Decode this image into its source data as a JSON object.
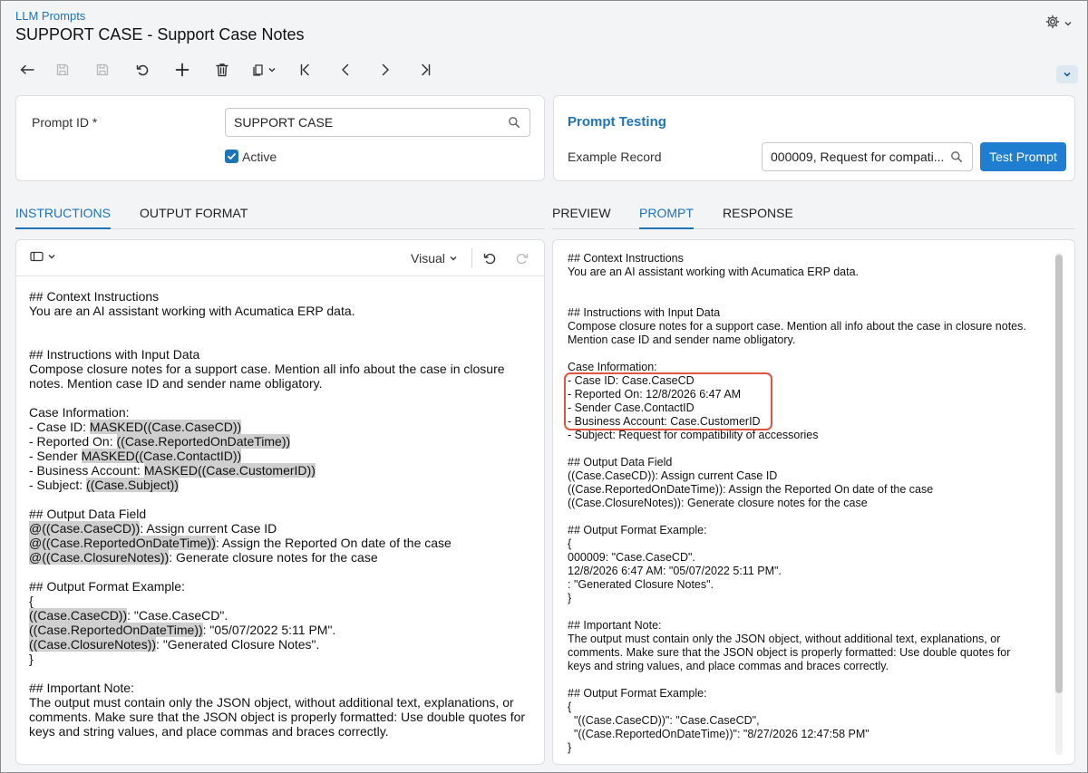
{
  "header": {
    "breadcrumb": "LLM Prompts",
    "title": "SUPPORT CASE - Support Case Notes"
  },
  "form": {
    "prompt_id_label": "Prompt ID *",
    "prompt_id_value": "SUPPORT CASE",
    "active_label": "Active"
  },
  "testing": {
    "title": "Prompt Testing",
    "example_record_label": "Example Record",
    "example_record_value": "000009, Request for compati...",
    "test_button": "Test Prompt"
  },
  "left_tabs": [
    "INSTRUCTIONS",
    "OUTPUT FORMAT"
  ],
  "right_tabs": [
    "PREVIEW",
    "PROMPT",
    "RESPONSE"
  ],
  "editor": {
    "mode_label": "Visual"
  },
  "instructions_lines": [
    {
      "segs": [
        {
          "t": "## Context Instructions"
        }
      ]
    },
    {
      "segs": [
        {
          "t": "You are an AI assistant working with Acumatica ERP data."
        }
      ]
    },
    {
      "segs": [
        {
          "t": ""
        }
      ]
    },
    {
      "segs": [
        {
          "t": ""
        }
      ]
    },
    {
      "segs": [
        {
          "t": "## Instructions with Input Data"
        }
      ]
    },
    {
      "segs": [
        {
          "t": "Compose closure notes for a support case. Mention all info about the case in closure"
        }
      ]
    },
    {
      "segs": [
        {
          "t": "notes. Mention case ID and sender name obligatory."
        }
      ]
    },
    {
      "segs": [
        {
          "t": ""
        }
      ]
    },
    {
      "segs": [
        {
          "t": "Case Information:"
        }
      ]
    },
    {
      "segs": [
        {
          "t": "- Case ID: "
        },
        {
          "t": "MASKED((Case.CaseCD))",
          "h": true
        }
      ]
    },
    {
      "segs": [
        {
          "t": "- Reported On: "
        },
        {
          "t": "((Case.ReportedOnDateTime))",
          "h": true
        }
      ]
    },
    {
      "segs": [
        {
          "t": "- Sender "
        },
        {
          "t": "MASKED((Case.ContactID))",
          "h": true
        }
      ]
    },
    {
      "segs": [
        {
          "t": "- Business Account: "
        },
        {
          "t": "MASKED((Case.CustomerID))",
          "h": true
        }
      ]
    },
    {
      "segs": [
        {
          "t": "- Subject: "
        },
        {
          "t": "((Case.Subject))",
          "h": true
        }
      ]
    },
    {
      "segs": [
        {
          "t": ""
        }
      ]
    },
    {
      "segs": [
        {
          "t": "## Output Data Field"
        }
      ]
    },
    {
      "segs": [
        {
          "t": "@((Case.CaseCD))",
          "h": true
        },
        {
          "t": ": Assign current Case ID"
        }
      ]
    },
    {
      "segs": [
        {
          "t": "@((Case.ReportedOnDateTime))",
          "h": true
        },
        {
          "t": ": Assign the Reported On date of the case"
        }
      ]
    },
    {
      "segs": [
        {
          "t": "@((Case.ClosureNotes))",
          "h": true
        },
        {
          "t": ": Generate closure notes for the case"
        }
      ]
    },
    {
      "segs": [
        {
          "t": ""
        }
      ]
    },
    {
      "segs": [
        {
          "t": "## Output Format Example:"
        }
      ]
    },
    {
      "segs": [
        {
          "t": "{"
        }
      ]
    },
    {
      "segs": [
        {
          "t": "((Case.CaseCD))",
          "h": true
        },
        {
          "t": ": \"Case.CaseCD\"."
        }
      ]
    },
    {
      "segs": [
        {
          "t": "((Case.ReportedOnDateTime))",
          "h": true
        },
        {
          "t": ": \"05/07/2022 5:11 PM\"."
        }
      ]
    },
    {
      "segs": [
        {
          "t": "((Case.ClosureNotes))",
          "h": true
        },
        {
          "t": ": \"Generated Closure Notes\"."
        }
      ]
    },
    {
      "segs": [
        {
          "t": "}"
        }
      ]
    },
    {
      "segs": [
        {
          "t": ""
        }
      ]
    },
    {
      "segs": [
        {
          "t": "## Important Note:"
        }
      ]
    },
    {
      "segs": [
        {
          "t": "The output must contain only the JSON object, without additional text, explanations, or"
        }
      ]
    },
    {
      "segs": [
        {
          "t": "comments. Make sure that the JSON object is properly formatted: Use double quotes for"
        }
      ]
    },
    {
      "segs": [
        {
          "t": "keys and string values, and place commas and braces correctly."
        }
      ]
    }
  ],
  "prompt_lines": [
    "## Context Instructions",
    "You are an AI assistant working with Acumatica ERP data.",
    "",
    "",
    "## Instructions with Input Data",
    "Compose closure notes for a support case. Mention all info about the case in closure notes.",
    "Mention case ID and sender name obligatory.",
    "",
    "Case Information:",
    "- Case ID: Case.CaseCD",
    "- Reported On: 12/8/2026 6:47 AM",
    "- Sender Case.ContactID",
    "- Business Account: Case.CustomerID",
    "- Subject: Request for compatibility of accessories",
    "",
    "## Output Data Field",
    "((Case.CaseCD)): Assign current Case ID",
    "((Case.ReportedOnDateTime)): Assign the Reported On date of the case",
    "((Case.ClosureNotes)): Generate closure notes for the case",
    "",
    "## Output Format Example:",
    "{",
    "000009: \"Case.CaseCD\".",
    "12/8/2026 6:47 AM: \"05/07/2022 5:11 PM\".",
    ": \"Generated Closure Notes\".",
    "}",
    "",
    "## Important Note:",
    "The output must contain only the JSON object, without additional text, explanations, or",
    "comments. Make sure that the JSON object is properly formatted: Use double quotes for",
    "keys and string values, and place commas and braces correctly.",
    "",
    "## Output Format Example:",
    "{",
    "  \"((Case.CaseCD))\": \"Case.CaseCD\",",
    "  \"((Case.ReportedOnDateTime))\": \"8/27/2026 12:47:58 PM\"",
    "}"
  ],
  "colors": {
    "accent": "#1f73b7",
    "primary_button": "#1f7ed0",
    "highlight": "#cfcfcf",
    "annotation_box": "#e0553f"
  }
}
